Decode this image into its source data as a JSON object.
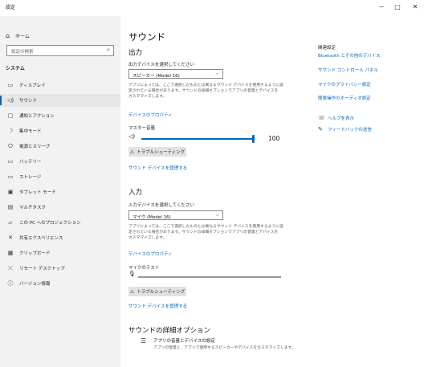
{
  "window": {
    "title": "設定",
    "minimize": "−",
    "maximize": "□",
    "close": "✕"
  },
  "sidebar": {
    "home": {
      "icon": "⌂",
      "label": "ホーム"
    },
    "search_placeholder": "設定の検索",
    "section": "システム",
    "items": [
      {
        "icon": "▭",
        "label": "ディスプレイ"
      },
      {
        "icon": "◁)",
        "label": "サウンド"
      },
      {
        "icon": "▢",
        "label": "通知とアクション"
      },
      {
        "icon": "☽",
        "label": "集中モード"
      },
      {
        "icon": "⏻",
        "label": "電源とスリープ"
      },
      {
        "icon": "▭",
        "label": "バッテリー"
      },
      {
        "icon": "▭",
        "label": "ストレージ"
      },
      {
        "icon": "▣",
        "label": "タブレット モード"
      },
      {
        "icon": "▤",
        "label": "マルチタスク"
      },
      {
        "icon": "▱",
        "label": "この PC へのプロジェクション"
      },
      {
        "icon": "✕",
        "label": "共有エクスペリエンス"
      },
      {
        "icon": "▦",
        "label": "クリップボード"
      },
      {
        "icon": "⤫",
        "label": "リモート デスクトップ"
      },
      {
        "icon": "ⓘ",
        "label": "バージョン情報"
      }
    ]
  },
  "main": {
    "title": "サウンド",
    "output": {
      "heading": "出力",
      "device_label": "出力デバイスを選択してください",
      "device_value": "スピーカー (Model 16)",
      "description_lines": [
        "アプリによっては、ここで選択したものとは異なるサウンド デバイスを使用するように設",
        "定されている場合があります。サウンドの詳細オプションでアプリの音量とデバイスを",
        "カスタマイズします。"
      ],
      "properties_link": "デバイスのプロパティ",
      "master_volume_label": "マスター音量",
      "volume_value": "100",
      "volume_fraction": 1.0,
      "troubleshoot_label": "トラブルシューティング",
      "manage_link": "サウンド デバイスを管理する"
    },
    "input": {
      "heading": "入力",
      "device_label": "入力デバイスを選択してください",
      "device_value": "マイク (Model 16)",
      "description_lines": [
        "アプリによっては、ここで選択したものとは異なるサウンド デバイスを使用するように設",
        "定されている場合があります。サウンドの詳細オプションでアプリの音量とデバイスを",
        "カスタマイズします。"
      ],
      "properties_link": "デバイスのプロパティ",
      "mic_test_label": "マイクのテスト",
      "mic_level_fraction": 0.0,
      "troubleshoot_label": "トラブルシューティング",
      "manage_link": "サウンド デバイスを管理する"
    },
    "advanced": {
      "heading": "サウンドの詳細オプション",
      "item_title": "アプリの音量とデバイスの設定",
      "item_desc": "アプリの音量と、アプリで使用するスピーカーやデバイスをカスタマイズします。"
    }
  },
  "related": {
    "heading": "関連設定",
    "links": [
      "Bluetooth とその他のデバイス",
      "サウンド コントロール パネル",
      "マイクのプライバシー設定",
      "簡単操作のオーディオ設定"
    ],
    "help": {
      "icon": "☏",
      "label": "ヘルプを表示"
    },
    "feedback": {
      "icon": "✎",
      "label": "フィードバックの送信"
    }
  },
  "colors": {
    "accent": "#0067c0",
    "sidebar_bg": "#f2f2f2",
    "track": "#999999"
  }
}
